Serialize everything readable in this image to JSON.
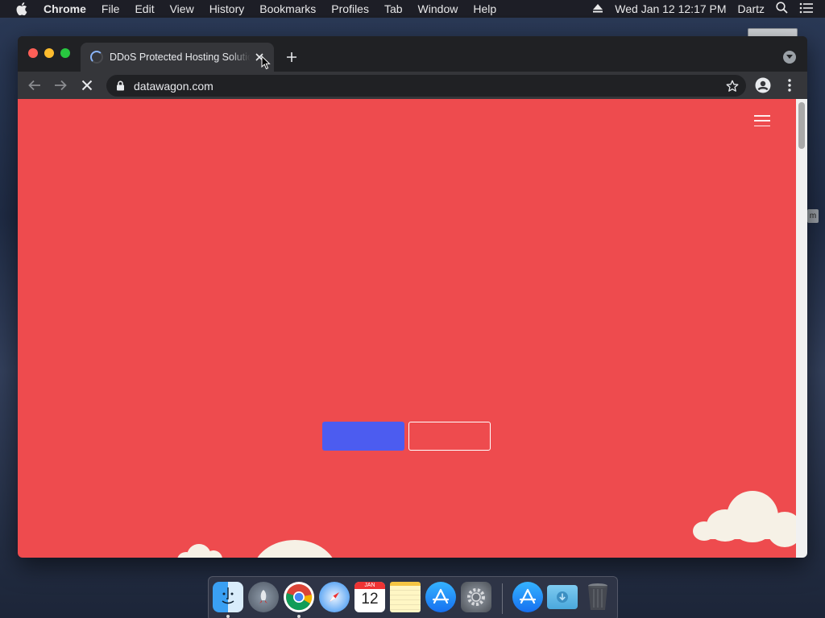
{
  "menubar": {
    "app_name": "Chrome",
    "items": [
      "File",
      "Edit",
      "View",
      "History",
      "Bookmarks",
      "Profiles",
      "Tab",
      "Window",
      "Help"
    ],
    "datetime": "Wed Jan 12  12:17 PM",
    "user": "Dartz"
  },
  "browser": {
    "tab_title": "DDoS Protected Hosting Solutions",
    "url": "datawagon.com",
    "loading": true
  },
  "colors": {
    "page_background": "#ee4b4e",
    "primary_button": "#4c5cf0",
    "chrome_dark": "#202124",
    "chrome_toolbar": "#35363a"
  },
  "dock": {
    "apps": [
      "finder-icon",
      "launchpad-icon",
      "chrome-icon",
      "safari-icon",
      "calendar-icon",
      "notes-icon",
      "app-store-icon",
      "system-preferences-icon",
      "app-store-download-icon",
      "downloads-folder-icon",
      "trash-icon"
    ],
    "calendar_month": "JAN",
    "calendar_day": "12"
  },
  "desktop": {
    "tag_text": "m"
  }
}
